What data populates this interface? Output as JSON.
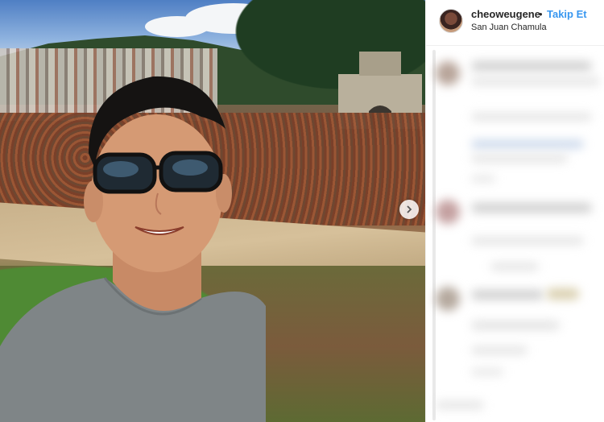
{
  "post": {
    "username": "cheoweugene",
    "separator": "•",
    "follow_label": "Takip Et",
    "location": "San Juan Chamula"
  },
  "photo": {
    "next_icon": "chevron-right-icon"
  },
  "colors": {
    "follow": "#3897f0",
    "text": "#262626",
    "divider": "#efefef"
  }
}
